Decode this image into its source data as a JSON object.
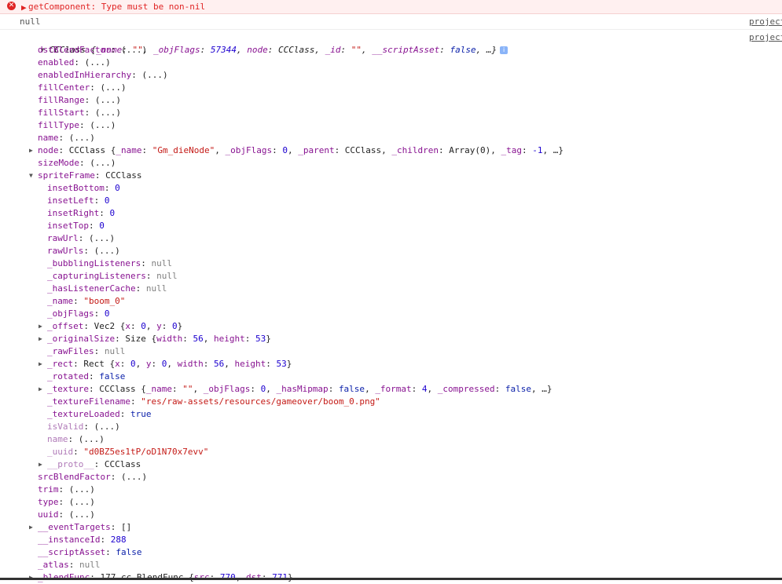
{
  "error": {
    "message": "getComponent: Type must be non-nil"
  },
  "null_log": {
    "text": "null",
    "source": "project"
  },
  "object_log": {
    "source": "project",
    "summary_parts": [
      {
        "t": "CCClass {",
        "c": "plain"
      },
      {
        "t": "_name",
        "c": "key"
      },
      {
        "t": ": ",
        "c": "plain"
      },
      {
        "t": "\"\"",
        "c": "str"
      },
      {
        "t": ", ",
        "c": "plain"
      },
      {
        "t": "_objFlags",
        "c": "key"
      },
      {
        "t": ": ",
        "c": "plain"
      },
      {
        "t": "57344",
        "c": "num"
      },
      {
        "t": ", ",
        "c": "plain"
      },
      {
        "t": "node",
        "c": "key"
      },
      {
        "t": ": CCClass, ",
        "c": "plain"
      },
      {
        "t": "_id",
        "c": "key"
      },
      {
        "t": ": ",
        "c": "plain"
      },
      {
        "t": "\"\"",
        "c": "str"
      },
      {
        "t": ", ",
        "c": "plain"
      },
      {
        "t": "__scriptAsset",
        "c": "key"
      },
      {
        "t": ": ",
        "c": "plain"
      },
      {
        "t": "false",
        "c": "bool"
      },
      {
        "t": ", …}",
        "c": "plain"
      }
    ],
    "lines": [
      {
        "indent": 1,
        "key": "dstBlendFactor",
        "parts": [
          {
            "t": "(...)",
            "c": "plain"
          }
        ]
      },
      {
        "indent": 1,
        "key": "enabled",
        "parts": [
          {
            "t": "(...)",
            "c": "plain"
          }
        ]
      },
      {
        "indent": 1,
        "key": "enabledInHierarchy",
        "parts": [
          {
            "t": "(...)",
            "c": "plain"
          }
        ]
      },
      {
        "indent": 1,
        "key": "fillCenter",
        "parts": [
          {
            "t": "(...)",
            "c": "plain"
          }
        ]
      },
      {
        "indent": 1,
        "key": "fillRange",
        "parts": [
          {
            "t": "(...)",
            "c": "plain"
          }
        ]
      },
      {
        "indent": 1,
        "key": "fillStart",
        "parts": [
          {
            "t": "(...)",
            "c": "plain"
          }
        ]
      },
      {
        "indent": 1,
        "key": "fillType",
        "parts": [
          {
            "t": "(...)",
            "c": "plain"
          }
        ]
      },
      {
        "indent": 1,
        "key": "name",
        "parts": [
          {
            "t": "(...)",
            "c": "plain"
          }
        ]
      },
      {
        "indent": 1,
        "key": "node",
        "toggle": "collapsed",
        "parts": [
          {
            "t": "CCClass {",
            "c": "plain"
          },
          {
            "t": "_name",
            "c": "key"
          },
          {
            "t": ": ",
            "c": "plain"
          },
          {
            "t": "\"Gm_dieNode\"",
            "c": "str"
          },
          {
            "t": ", ",
            "c": "plain"
          },
          {
            "t": "_objFlags",
            "c": "key"
          },
          {
            "t": ": ",
            "c": "plain"
          },
          {
            "t": "0",
            "c": "num"
          },
          {
            "t": ", ",
            "c": "plain"
          },
          {
            "t": "_parent",
            "c": "key"
          },
          {
            "t": ": CCClass, ",
            "c": "plain"
          },
          {
            "t": "_children",
            "c": "key"
          },
          {
            "t": ": Array(0), ",
            "c": "plain"
          },
          {
            "t": "_tag",
            "c": "key"
          },
          {
            "t": ": ",
            "c": "plain"
          },
          {
            "t": "-1",
            "c": "num"
          },
          {
            "t": ", …}",
            "c": "plain"
          }
        ]
      },
      {
        "indent": 1,
        "key": "sizeMode",
        "parts": [
          {
            "t": "(...)",
            "c": "plain"
          }
        ]
      },
      {
        "indent": 1,
        "key": "spriteFrame",
        "toggle": "expanded",
        "parts": [
          {
            "t": "CCClass",
            "c": "plain"
          }
        ]
      },
      {
        "indent": 2,
        "key": "insetBottom",
        "parts": [
          {
            "t": "0",
            "c": "num"
          }
        ]
      },
      {
        "indent": 2,
        "key": "insetLeft",
        "parts": [
          {
            "t": "0",
            "c": "num"
          }
        ]
      },
      {
        "indent": 2,
        "key": "insetRight",
        "parts": [
          {
            "t": "0",
            "c": "num"
          }
        ]
      },
      {
        "indent": 2,
        "key": "insetTop",
        "parts": [
          {
            "t": "0",
            "c": "num"
          }
        ]
      },
      {
        "indent": 2,
        "key": "rawUrl",
        "parts": [
          {
            "t": "(...)",
            "c": "plain"
          }
        ]
      },
      {
        "indent": 2,
        "key": "rawUrls",
        "parts": [
          {
            "t": "(...)",
            "c": "plain"
          }
        ]
      },
      {
        "indent": 2,
        "key": "_bubblingListeners",
        "parts": [
          {
            "t": "null",
            "c": "nul"
          }
        ]
      },
      {
        "indent": 2,
        "key": "_capturingListeners",
        "parts": [
          {
            "t": "null",
            "c": "nul"
          }
        ]
      },
      {
        "indent": 2,
        "key": "_hasListenerCache",
        "parts": [
          {
            "t": "null",
            "c": "nul"
          }
        ]
      },
      {
        "indent": 2,
        "key": "_name",
        "parts": [
          {
            "t": "\"boom_0\"",
            "c": "str"
          }
        ]
      },
      {
        "indent": 2,
        "key": "_objFlags",
        "parts": [
          {
            "t": "0",
            "c": "num"
          }
        ]
      },
      {
        "indent": 2,
        "key": "_offset",
        "toggle": "collapsed",
        "parts": [
          {
            "t": "Vec2 {",
            "c": "plain"
          },
          {
            "t": "x",
            "c": "key"
          },
          {
            "t": ": ",
            "c": "plain"
          },
          {
            "t": "0",
            "c": "num"
          },
          {
            "t": ", ",
            "c": "plain"
          },
          {
            "t": "y",
            "c": "key"
          },
          {
            "t": ": ",
            "c": "plain"
          },
          {
            "t": "0",
            "c": "num"
          },
          {
            "t": "}",
            "c": "plain"
          }
        ]
      },
      {
        "indent": 2,
        "key": "_originalSize",
        "toggle": "collapsed",
        "parts": [
          {
            "t": "Size {",
            "c": "plain"
          },
          {
            "t": "width",
            "c": "key"
          },
          {
            "t": ": ",
            "c": "plain"
          },
          {
            "t": "56",
            "c": "num"
          },
          {
            "t": ", ",
            "c": "plain"
          },
          {
            "t": "height",
            "c": "key"
          },
          {
            "t": ": ",
            "c": "plain"
          },
          {
            "t": "53",
            "c": "num"
          },
          {
            "t": "}",
            "c": "plain"
          }
        ]
      },
      {
        "indent": 2,
        "key": "_rawFiles",
        "parts": [
          {
            "t": "null",
            "c": "nul"
          }
        ]
      },
      {
        "indent": 2,
        "key": "_rect",
        "toggle": "collapsed",
        "parts": [
          {
            "t": "Rect {",
            "c": "plain"
          },
          {
            "t": "x",
            "c": "key"
          },
          {
            "t": ": ",
            "c": "plain"
          },
          {
            "t": "0",
            "c": "num"
          },
          {
            "t": ", ",
            "c": "plain"
          },
          {
            "t": "y",
            "c": "key"
          },
          {
            "t": ": ",
            "c": "plain"
          },
          {
            "t": "0",
            "c": "num"
          },
          {
            "t": ", ",
            "c": "plain"
          },
          {
            "t": "width",
            "c": "key"
          },
          {
            "t": ": ",
            "c": "plain"
          },
          {
            "t": "56",
            "c": "num"
          },
          {
            "t": ", ",
            "c": "plain"
          },
          {
            "t": "height",
            "c": "key"
          },
          {
            "t": ": ",
            "c": "plain"
          },
          {
            "t": "53",
            "c": "num"
          },
          {
            "t": "}",
            "c": "plain"
          }
        ]
      },
      {
        "indent": 2,
        "key": "_rotated",
        "parts": [
          {
            "t": "false",
            "c": "bool"
          }
        ]
      },
      {
        "indent": 2,
        "key": "_texture",
        "toggle": "collapsed",
        "parts": [
          {
            "t": "CCClass {",
            "c": "plain"
          },
          {
            "t": "_name",
            "c": "key"
          },
          {
            "t": ": ",
            "c": "plain"
          },
          {
            "t": "\"\"",
            "c": "str"
          },
          {
            "t": ", ",
            "c": "plain"
          },
          {
            "t": "_objFlags",
            "c": "key"
          },
          {
            "t": ": ",
            "c": "plain"
          },
          {
            "t": "0",
            "c": "num"
          },
          {
            "t": ", ",
            "c": "plain"
          },
          {
            "t": "_hasMipmap",
            "c": "key"
          },
          {
            "t": ": ",
            "c": "plain"
          },
          {
            "t": "false",
            "c": "bool"
          },
          {
            "t": ", ",
            "c": "plain"
          },
          {
            "t": "_format",
            "c": "key"
          },
          {
            "t": ": ",
            "c": "plain"
          },
          {
            "t": "4",
            "c": "num"
          },
          {
            "t": ", ",
            "c": "plain"
          },
          {
            "t": "_compressed",
            "c": "key"
          },
          {
            "t": ": ",
            "c": "plain"
          },
          {
            "t": "false",
            "c": "bool"
          },
          {
            "t": ", …}",
            "c": "plain"
          }
        ]
      },
      {
        "indent": 2,
        "key": "_textureFilename",
        "parts": [
          {
            "t": "\"res/raw-assets/resources/gameover/boom_0.png\"",
            "c": "str"
          }
        ]
      },
      {
        "indent": 2,
        "key": "_textureLoaded",
        "parts": [
          {
            "t": "true",
            "c": "bool"
          }
        ]
      },
      {
        "indent": 2,
        "key": "isValid",
        "dim": true,
        "parts": [
          {
            "t": "(...)",
            "c": "plain"
          }
        ]
      },
      {
        "indent": 2,
        "key": "name",
        "dim": true,
        "parts": [
          {
            "t": "(...)",
            "c": "plain"
          }
        ]
      },
      {
        "indent": 2,
        "key": "_uuid",
        "dim": true,
        "parts": [
          {
            "t": "\"d0BZ5es1tP/oD1N70x7evv\"",
            "c": "str"
          }
        ]
      },
      {
        "indent": 2,
        "key": "__proto__",
        "dim": true,
        "toggle": "collapsed",
        "parts": [
          {
            "t": "CCClass",
            "c": "plain"
          }
        ]
      },
      {
        "indent": 1,
        "key": "srcBlendFactor",
        "parts": [
          {
            "t": "(...)",
            "c": "plain"
          }
        ]
      },
      {
        "indent": 1,
        "key": "trim",
        "parts": [
          {
            "t": "(...)",
            "c": "plain"
          }
        ]
      },
      {
        "indent": 1,
        "key": "type",
        "parts": [
          {
            "t": "(...)",
            "c": "plain"
          }
        ]
      },
      {
        "indent": 1,
        "key": "uuid",
        "parts": [
          {
            "t": "(...)",
            "c": "plain"
          }
        ]
      },
      {
        "indent": 1,
        "key": "__eventTargets",
        "toggle": "collapsed",
        "parts": [
          {
            "t": "[]",
            "c": "plain"
          }
        ]
      },
      {
        "indent": 1,
        "key": "__instanceId",
        "parts": [
          {
            "t": "288",
            "c": "num"
          }
        ]
      },
      {
        "indent": 1,
        "key": "__scriptAsset",
        "parts": [
          {
            "t": "false",
            "c": "bool"
          }
        ]
      },
      {
        "indent": 1,
        "key": "_atlas",
        "parts": [
          {
            "t": "null",
            "c": "nul"
          }
        ]
      },
      {
        "indent": 1,
        "key": "_blendFunc",
        "toggle": "collapsed",
        "parts": [
          {
            "t": "177 cc.BlendFunc {",
            "c": "plain"
          },
          {
            "t": "src",
            "c": "key"
          },
          {
            "t": ": ",
            "c": "plain"
          },
          {
            "t": "770",
            "c": "num"
          },
          {
            "t": ", ",
            "c": "plain"
          },
          {
            "t": "dst",
            "c": "key"
          },
          {
            "t": ": ",
            "c": "plain"
          },
          {
            "t": "771",
            "c": "num"
          },
          {
            "t": "}",
            "c": "plain"
          }
        ]
      }
    ]
  },
  "colors": {
    "error_bg": "#fff0f0",
    "error_text": "#e02424",
    "key": "#881391",
    "string": "#c41a16",
    "number": "#1c00cf",
    "boolean": "#0d22aa",
    "null": "#808080"
  }
}
